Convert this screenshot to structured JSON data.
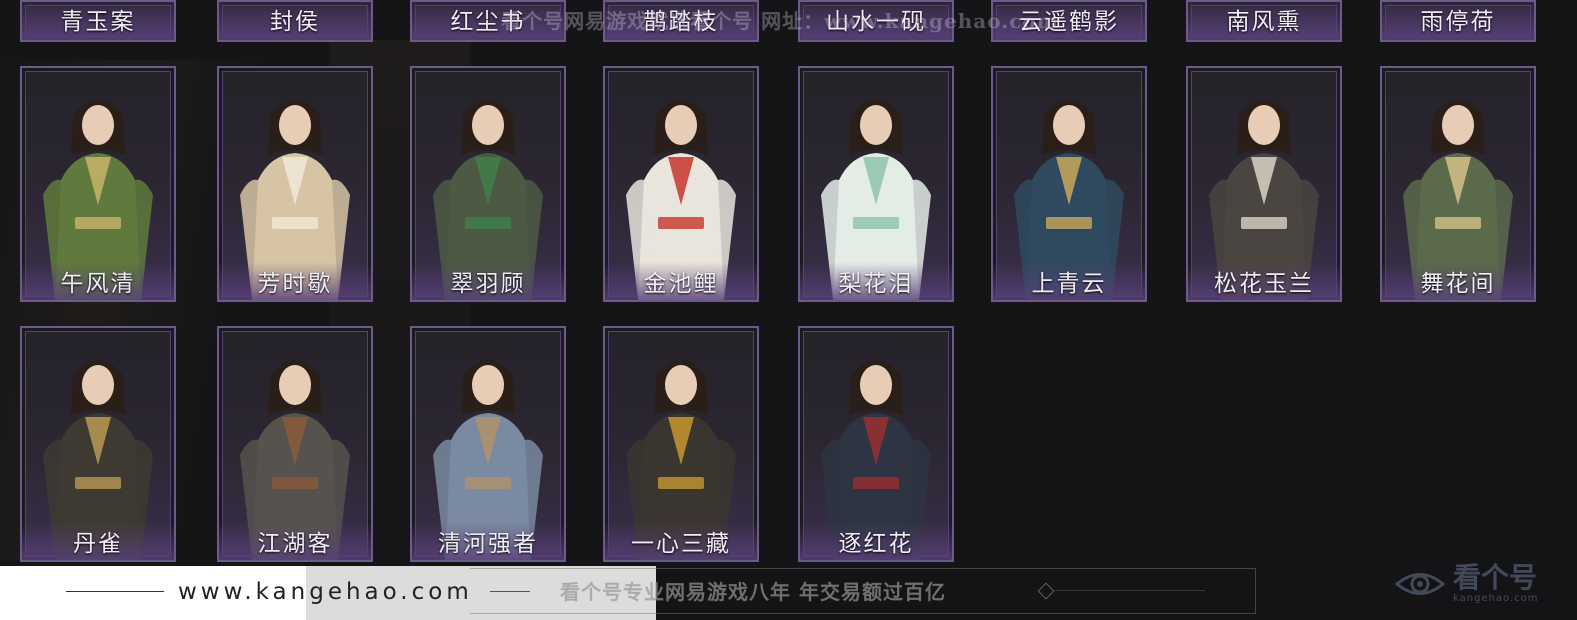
{
  "watermark": {
    "top_text": "看个号网易游戏就选看个号   网址：www.kangehao.com"
  },
  "row_top": [
    {
      "name": "青玉案"
    },
    {
      "name": "封侯"
    },
    {
      "name": "红尘书"
    },
    {
      "name": "鹊踏枝"
    },
    {
      "name": "山水一砚"
    },
    {
      "name": "云遥鹤影"
    },
    {
      "name": "南风熏"
    },
    {
      "name": "雨停荷"
    }
  ],
  "row_middle": [
    {
      "name": "午风清",
      "robe": "#5f7a3c",
      "accent": "#c8b56a"
    },
    {
      "name": "芳时歇",
      "robe": "#d6c4a4",
      "accent": "#f0ead8"
    },
    {
      "name": "翠羽顾",
      "robe": "#4c5a44",
      "accent": "#3f7f4c"
    },
    {
      "name": "金池鲤",
      "robe": "#e9e4dc",
      "accent": "#c8362c"
    },
    {
      "name": "梨花泪",
      "robe": "#e4ece6",
      "accent": "#8fc3a8"
    },
    {
      "name": "上青云",
      "robe": "#2f4a5e",
      "accent": "#c9a85a"
    },
    {
      "name": "松花玉兰",
      "robe": "#4a4541",
      "accent": "#d8d2c8"
    },
    {
      "name": "舞花间",
      "robe": "#5a6a4a",
      "accent": "#d6c08a"
    }
  ],
  "row_bottom": [
    {
      "name": "丹雀",
      "robe": "#3e3a32",
      "accent": "#b79a52"
    },
    {
      "name": "江湖客",
      "robe": "#56524e",
      "accent": "#8a5a3a"
    },
    {
      "name": "清河强者",
      "robe": "#7a8aa0",
      "accent": "#b0906a"
    },
    {
      "name": "一心三藏",
      "robe": "#3b3530",
      "accent": "#c8962e"
    },
    {
      "name": "逐红花",
      "robe": "#2e3442",
      "accent": "#9a3030"
    }
  ],
  "footer": {
    "url": "www.kangehao.com",
    "slogan": "看个号专业网易游戏八年  年交易额过百亿"
  },
  "logo": {
    "name": "看个号",
    "domain": "kangehao.com",
    "icon": "eye-logo-icon"
  }
}
